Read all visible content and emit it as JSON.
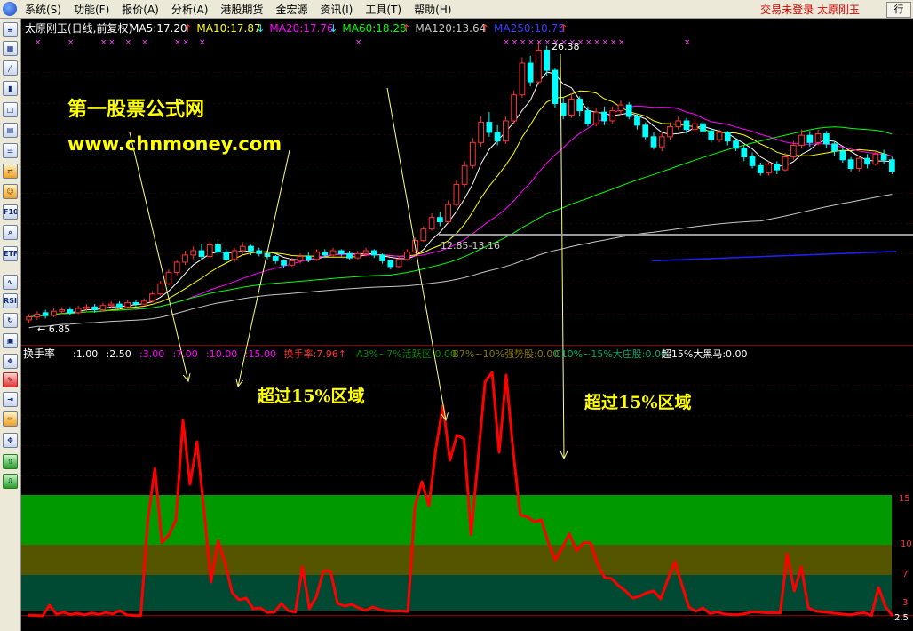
{
  "menu": {
    "items": [
      "系统(S)",
      "功能(F)",
      "报价(A)",
      "分析(A)",
      "港股期货",
      "金宏源",
      "资讯(I)",
      "工具(T)",
      "帮助(H)"
    ],
    "status_text": "交易未登录  太原刚玉",
    "corner_text": "行"
  },
  "toolbar": {
    "icons": [
      {
        "name": "quote-list-icon",
        "glyph": "≡"
      },
      {
        "name": "grid-icon",
        "glyph": "▦"
      },
      {
        "name": "line-chart-icon",
        "glyph": "╱"
      },
      {
        "name": "kline-icon",
        "glyph": "▮"
      },
      {
        "name": "window-icon",
        "glyph": "□"
      },
      {
        "name": "table-icon",
        "glyph": "▤"
      },
      {
        "name": "list-icon",
        "glyph": "☰"
      },
      {
        "name": "swap-icon",
        "glyph": "⇄"
      },
      {
        "name": "users-icon",
        "glyph": "☺"
      },
      {
        "name": "f10-icon",
        "glyph": "F10"
      },
      {
        "name": "search-icon",
        "glyph": "⌕"
      },
      {
        "name": "etf-icon",
        "glyph": "ETF"
      },
      {
        "name": "wave-icon",
        "glyph": "∿"
      },
      {
        "name": "rsi-icon",
        "glyph": "RSI"
      },
      {
        "name": "refresh-icon",
        "glyph": "↻"
      },
      {
        "name": "calc-icon",
        "glyph": "▣"
      },
      {
        "name": "bookmark-icon",
        "glyph": "❖"
      },
      {
        "name": "tools-icon",
        "glyph": "✎"
      },
      {
        "name": "export-icon",
        "glyph": "⇥"
      },
      {
        "name": "pencil-icon",
        "glyph": "✏"
      },
      {
        "name": "move-icon",
        "glyph": "✥"
      },
      {
        "name": "arrow-up-icon",
        "glyph": "⇧"
      },
      {
        "name": "arrow-down-icon",
        "glyph": "⇩"
      }
    ]
  },
  "colors": {
    "bg": "#000000",
    "up": "#ff3232",
    "down": "#00ffff",
    "ma5": "#ffffff",
    "ma10": "#ffff00",
    "ma20": "#ff00ff",
    "ma60": "#00ff00",
    "ma120": "#c8c8c8",
    "ma250": "#2020ff",
    "turnover": "#ff0000",
    "watermark": "#ffff00"
  },
  "main_panel": {
    "title": "太原刚玉(日线,前复权)",
    "ma": [
      {
        "text": "MA5:17.20",
        "arrow": "↑",
        "color": "#ffffff"
      },
      {
        "text": "MA10:17.87",
        "arrow": "↓",
        "color": "#ffff00"
      },
      {
        "text": "MA20:17.76",
        "arrow": "↓",
        "color": "#ff00ff"
      },
      {
        "text": "MA60:18.28",
        "arrow": "↑",
        "color": "#00ff00"
      },
      {
        "text": "MA120:13.64",
        "arrow": "↑",
        "color": "#c8c8c8"
      },
      {
        "text": "MA250:10.75",
        "arrow": "↑",
        "color": "#3a3aff"
      }
    ],
    "high_label": "26.38",
    "low_label": "← 6.85",
    "gap_label": "12.85-13.16",
    "watermark_title": "第一股票公式网",
    "watermark_url": "www.chnmoney.com"
  },
  "sub_panel": {
    "title": "换手率",
    "params": [
      {
        "text": ":1.00",
        "color": "#ffffff"
      },
      {
        "text": ":2.50",
        "color": "#ffffff"
      },
      {
        "text": ":3.00",
        "color": "#ff00ff"
      },
      {
        "text": ":7.00",
        "color": "#ff00ff"
      },
      {
        "text": ":10.00",
        "color": "#ff00ff"
      },
      {
        "text": ":15.00",
        "color": "#ff00ff"
      },
      {
        "text": "换手率:7.96↑",
        "color": "#ff3232"
      },
      {
        "text": "A3%~7%活跃区:0.00",
        "color": "#008800"
      },
      {
        "text": "B7%~10%强势股:0.00",
        "color": "#887700"
      },
      {
        "text": "C10%~15%大庄股:0.00",
        "color": "#00aa66"
      },
      {
        "text": "超15%大黑马:0.00",
        "color": "#ffffff"
      }
    ],
    "annotation_left": "超过15%区域",
    "annotation_right": "超过15%区域",
    "right_ticks": [
      "15",
      "10",
      "7",
      "3",
      "2.5"
    ]
  },
  "chart_data": {
    "type": "candlestick",
    "price_range": [
      6.85,
      26.38
    ],
    "candles": [
      {
        "o": 7.1,
        "c": 7.3,
        "h": 7.5,
        "l": 6.85
      },
      {
        "o": 7.3,
        "c": 7.5,
        "h": 7.7,
        "l": 7.1
      },
      {
        "o": 7.6,
        "c": 7.4,
        "h": 7.8,
        "l": 7.2
      },
      {
        "o": 7.4,
        "c": 7.7,
        "h": 7.9,
        "l": 7.3
      },
      {
        "o": 7.7,
        "c": 7.8,
        "h": 8.0,
        "l": 7.5
      },
      {
        "o": 7.8,
        "c": 7.6,
        "h": 8.0,
        "l": 7.4
      },
      {
        "o": 7.6,
        "c": 7.9,
        "h": 8.1,
        "l": 7.5
      },
      {
        "o": 7.9,
        "c": 8.0,
        "h": 8.2,
        "l": 7.7
      },
      {
        "o": 8.0,
        "c": 7.8,
        "h": 8.2,
        "l": 7.6
      },
      {
        "o": 7.8,
        "c": 8.1,
        "h": 8.3,
        "l": 7.7
      },
      {
        "o": 8.1,
        "c": 8.2,
        "h": 8.4,
        "l": 7.9
      },
      {
        "o": 8.2,
        "c": 8.0,
        "h": 8.4,
        "l": 7.9
      },
      {
        "o": 8.0,
        "c": 8.3,
        "h": 8.5,
        "l": 7.9
      },
      {
        "o": 8.3,
        "c": 8.2,
        "h": 8.5,
        "l": 8.0
      },
      {
        "o": 8.2,
        "c": 8.4,
        "h": 8.6,
        "l": 8.1
      },
      {
        "o": 8.4,
        "c": 8.9,
        "h": 9.1,
        "l": 8.3
      },
      {
        "o": 8.9,
        "c": 9.6,
        "h": 9.8,
        "l": 8.8
      },
      {
        "o": 9.6,
        "c": 10.4,
        "h": 10.6,
        "l": 9.5
      },
      {
        "o": 10.4,
        "c": 11.1,
        "h": 11.3,
        "l": 10.2
      },
      {
        "o": 11.1,
        "c": 11.6,
        "h": 11.9,
        "l": 10.9
      },
      {
        "o": 11.6,
        "c": 11.9,
        "h": 12.2,
        "l": 11.3
      },
      {
        "o": 11.9,
        "c": 11.5,
        "h": 12.4,
        "l": 11.3
      },
      {
        "o": 11.5,
        "c": 12.3,
        "h": 12.6,
        "l": 11.4
      },
      {
        "o": 12.3,
        "c": 11.8,
        "h": 12.6,
        "l": 11.6
      },
      {
        "o": 11.8,
        "c": 11.3,
        "h": 12.0,
        "l": 11.1
      },
      {
        "o": 11.3,
        "c": 11.9,
        "h": 12.1,
        "l": 11.1
      },
      {
        "o": 11.9,
        "c": 12.2,
        "h": 12.5,
        "l": 11.7
      },
      {
        "o": 12.2,
        "c": 11.9,
        "h": 12.3,
        "l": 11.6
      },
      {
        "o": 11.9,
        "c": 11.7,
        "h": 12.1,
        "l": 11.5
      },
      {
        "o": 11.7,
        "c": 11.5,
        "h": 11.9,
        "l": 11.3
      },
      {
        "o": 11.5,
        "c": 11.2,
        "h": 11.6,
        "l": 11.0
      },
      {
        "o": 11.2,
        "c": 10.9,
        "h": 11.3,
        "l": 10.7
      },
      {
        "o": 10.9,
        "c": 11.2,
        "h": 11.4,
        "l": 10.8
      },
      {
        "o": 11.2,
        "c": 11.5,
        "h": 11.7,
        "l": 11.0
      },
      {
        "o": 11.5,
        "c": 11.3,
        "h": 11.8,
        "l": 11.1
      },
      {
        "o": 11.3,
        "c": 11.8,
        "h": 12.0,
        "l": 11.2
      },
      {
        "o": 11.8,
        "c": 11.6,
        "h": 12.0,
        "l": 11.4
      },
      {
        "o": 11.6,
        "c": 11.9,
        "h": 12.1,
        "l": 11.5
      },
      {
        "o": 11.9,
        "c": 11.7,
        "h": 12.0,
        "l": 11.5
      },
      {
        "o": 11.7,
        "c": 11.4,
        "h": 11.9,
        "l": 11.3
      },
      {
        "o": 11.4,
        "c": 11.7,
        "h": 11.9,
        "l": 11.3
      },
      {
        "o": 11.7,
        "c": 11.9,
        "h": 12.1,
        "l": 11.5
      },
      {
        "o": 11.9,
        "c": 11.6,
        "h": 12.0,
        "l": 11.4
      },
      {
        "o": 11.6,
        "c": 11.2,
        "h": 11.7,
        "l": 11.0
      },
      {
        "o": 11.2,
        "c": 10.8,
        "h": 11.3,
        "l": 10.6
      },
      {
        "o": 10.8,
        "c": 11.3,
        "h": 11.5,
        "l": 10.7
      },
      {
        "o": 11.3,
        "c": 11.8,
        "h": 12.0,
        "l": 11.2
      },
      {
        "o": 11.8,
        "c": 12.6,
        "h": 12.8,
        "l": 11.7
      },
      {
        "o": 12.6,
        "c": 13.4,
        "h": 13.6,
        "l": 12.5
      },
      {
        "o": 13.4,
        "c": 14.2,
        "h": 14.5,
        "l": 13.3
      },
      {
        "o": 14.2,
        "c": 13.9,
        "h": 14.6,
        "l": 13.6
      },
      {
        "o": 13.9,
        "c": 15.1,
        "h": 15.4,
        "l": 13.8
      },
      {
        "o": 15.1,
        "c": 16.5,
        "h": 16.8,
        "l": 15.0
      },
      {
        "o": 16.5,
        "c": 17.8,
        "h": 18.1,
        "l": 16.3
      },
      {
        "o": 17.8,
        "c": 19.4,
        "h": 19.7,
        "l": 17.6
      },
      {
        "o": 19.4,
        "c": 20.8,
        "h": 21.2,
        "l": 19.1
      },
      {
        "o": 20.8,
        "c": 20.1,
        "h": 21.5,
        "l": 19.8
      },
      {
        "o": 20.1,
        "c": 19.5,
        "h": 20.6,
        "l": 19.2
      },
      {
        "o": 19.5,
        "c": 20.9,
        "h": 21.2,
        "l": 19.3
      },
      {
        "o": 20.9,
        "c": 22.7,
        "h": 23.0,
        "l": 20.7
      },
      {
        "o": 22.7,
        "c": 24.9,
        "h": 25.3,
        "l": 22.5
      },
      {
        "o": 24.9,
        "c": 23.6,
        "h": 25.4,
        "l": 23.3
      },
      {
        "o": 23.6,
        "c": 25.8,
        "h": 26.38,
        "l": 23.4
      },
      {
        "o": 25.8,
        "c": 24.4,
        "h": 26.1,
        "l": 24.0
      },
      {
        "o": 24.4,
        "c": 22.1,
        "h": 24.6,
        "l": 21.8
      },
      {
        "o": 22.1,
        "c": 21.3,
        "h": 22.5,
        "l": 21.0
      },
      {
        "o": 21.3,
        "c": 22.4,
        "h": 22.8,
        "l": 21.1
      },
      {
        "o": 22.4,
        "c": 21.6,
        "h": 22.6,
        "l": 21.2
      },
      {
        "o": 21.6,
        "c": 20.7,
        "h": 21.9,
        "l": 20.5
      },
      {
        "o": 20.7,
        "c": 21.5,
        "h": 21.8,
        "l": 20.5
      },
      {
        "o": 21.5,
        "c": 20.9,
        "h": 21.9,
        "l": 20.6
      },
      {
        "o": 20.9,
        "c": 21.6,
        "h": 21.9,
        "l": 20.7
      },
      {
        "o": 21.6,
        "c": 22.0,
        "h": 22.3,
        "l": 21.3
      },
      {
        "o": 22.0,
        "c": 21.2,
        "h": 22.2,
        "l": 21.0
      },
      {
        "o": 21.2,
        "c": 20.6,
        "h": 21.4,
        "l": 20.3
      },
      {
        "o": 20.6,
        "c": 19.8,
        "h": 20.8,
        "l": 19.6
      },
      {
        "o": 19.8,
        "c": 19.1,
        "h": 20.1,
        "l": 18.9
      },
      {
        "o": 19.1,
        "c": 19.8,
        "h": 20.1,
        "l": 18.8
      },
      {
        "o": 19.8,
        "c": 20.5,
        "h": 20.8,
        "l": 19.6
      },
      {
        "o": 20.5,
        "c": 20.9,
        "h": 21.2,
        "l": 20.3
      },
      {
        "o": 20.9,
        "c": 20.3,
        "h": 21.1,
        "l": 20.0
      },
      {
        "o": 20.3,
        "c": 20.7,
        "h": 21.0,
        "l": 20.1
      },
      {
        "o": 20.7,
        "c": 20.2,
        "h": 20.9,
        "l": 19.9
      },
      {
        "o": 20.2,
        "c": 19.6,
        "h": 20.4,
        "l": 19.4
      },
      {
        "o": 19.6,
        "c": 20.1,
        "h": 20.3,
        "l": 19.4
      },
      {
        "o": 20.1,
        "c": 19.5,
        "h": 20.2,
        "l": 19.2
      },
      {
        "o": 19.5,
        "c": 19.0,
        "h": 19.7,
        "l": 18.8
      },
      {
        "o": 19.0,
        "c": 18.4,
        "h": 19.2,
        "l": 18.1
      },
      {
        "o": 18.4,
        "c": 17.8,
        "h": 18.7,
        "l": 17.6
      },
      {
        "o": 17.8,
        "c": 17.3,
        "h": 18.0,
        "l": 17.1
      },
      {
        "o": 17.3,
        "c": 17.9,
        "h": 18.1,
        "l": 17.1
      },
      {
        "o": 17.9,
        "c": 17.5,
        "h": 18.1,
        "l": 17.2
      },
      {
        "o": 17.5,
        "c": 18.4,
        "h": 18.7,
        "l": 17.4
      },
      {
        "o": 18.4,
        "c": 19.2,
        "h": 19.5,
        "l": 18.2
      },
      {
        "o": 19.2,
        "c": 19.9,
        "h": 20.3,
        "l": 19.0
      },
      {
        "o": 19.9,
        "c": 19.4,
        "h": 20.2,
        "l": 19.1
      },
      {
        "o": 19.4,
        "c": 20.0,
        "h": 20.3,
        "l": 19.2
      },
      {
        "o": 20.0,
        "c": 19.3,
        "h": 20.2,
        "l": 19.0
      },
      {
        "o": 19.3,
        "c": 18.8,
        "h": 19.5,
        "l": 18.5
      },
      {
        "o": 18.8,
        "c": 18.2,
        "h": 19.0,
        "l": 18.0
      },
      {
        "o": 18.2,
        "c": 17.6,
        "h": 18.4,
        "l": 17.4
      },
      {
        "o": 17.6,
        "c": 18.3,
        "h": 18.5,
        "l": 17.4
      },
      {
        "o": 18.3,
        "c": 17.9,
        "h": 18.6,
        "l": 17.6
      },
      {
        "o": 17.9,
        "c": 18.6,
        "h": 18.8,
        "l": 17.8
      },
      {
        "o": 18.6,
        "c": 18.2,
        "h": 18.9,
        "l": 17.9
      },
      {
        "o": 18.2,
        "c": 17.4,
        "h": 18.4,
        "l": 17.2
      }
    ],
    "ma250": [
      [
        0.72,
        11.2
      ],
      [
        1.0,
        11.85
      ]
    ],
    "turnover": [
      1.1,
      1.0,
      0.8,
      3.6,
      1.5,
      2.3,
      1.4,
      1.9,
      1.2,
      2.0,
      1.4,
      2.2,
      1.6,
      3.0,
      1.2,
      1.0,
      0.9,
      12.5,
      17.0,
      10.2,
      11.0,
      12.5,
      20.6,
      15.8,
      19.0,
      13.5,
      6.2,
      10.4,
      8.2,
      5.0,
      4.2,
      4.4,
      3.2,
      3.3,
      2.2,
      2.3,
      3.8,
      2.9,
      2.4,
      7.8,
      3.2,
      4.6,
      7.4,
      7.4,
      3.8,
      3.5,
      3.7,
      3.3,
      3.0,
      3.4,
      3.1,
      2.9,
      2.8,
      2.8,
      2.6,
      13.8,
      16.0,
      13.9,
      18.5,
      21.7,
      17.6,
      19.5,
      19.2,
      11.0,
      17.7,
      23.5,
      24.2,
      18.2,
      24.0,
      18.3,
      13.0,
      12.8,
      12.3,
      12.5,
      10.2,
      8.5,
      9.7,
      11.1,
      9.4,
      10.2,
      10.2,
      8.1,
      6.7,
      6.6,
      5.8,
      5.2,
      4.4,
      4.6,
      5.0,
      5.2,
      4.3,
      6.5,
      8.3,
      5.9,
      3.4,
      2.7,
      3.3,
      1.8,
      2.4,
      1.6,
      1.3,
      1.3,
      1.7,
      2.4,
      2.3,
      2.1,
      2.1,
      2.0,
      9.1,
      5.2,
      7.8,
      3.3,
      2.8,
      2.4,
      2.2,
      1.8,
      1.5,
      1.2,
      1.8,
      2.1,
      1.0,
      5.6,
      3.4,
      0.8
    ],
    "zones": [
      {
        "from": 10,
        "to": 15,
        "color": "#009900"
      },
      {
        "from": 7,
        "to": 10,
        "color": "#555500"
      },
      {
        "from": 3,
        "to": 7,
        "color": "#004a33"
      }
    ],
    "turnover_range": [
      0.8,
      25
    ]
  }
}
